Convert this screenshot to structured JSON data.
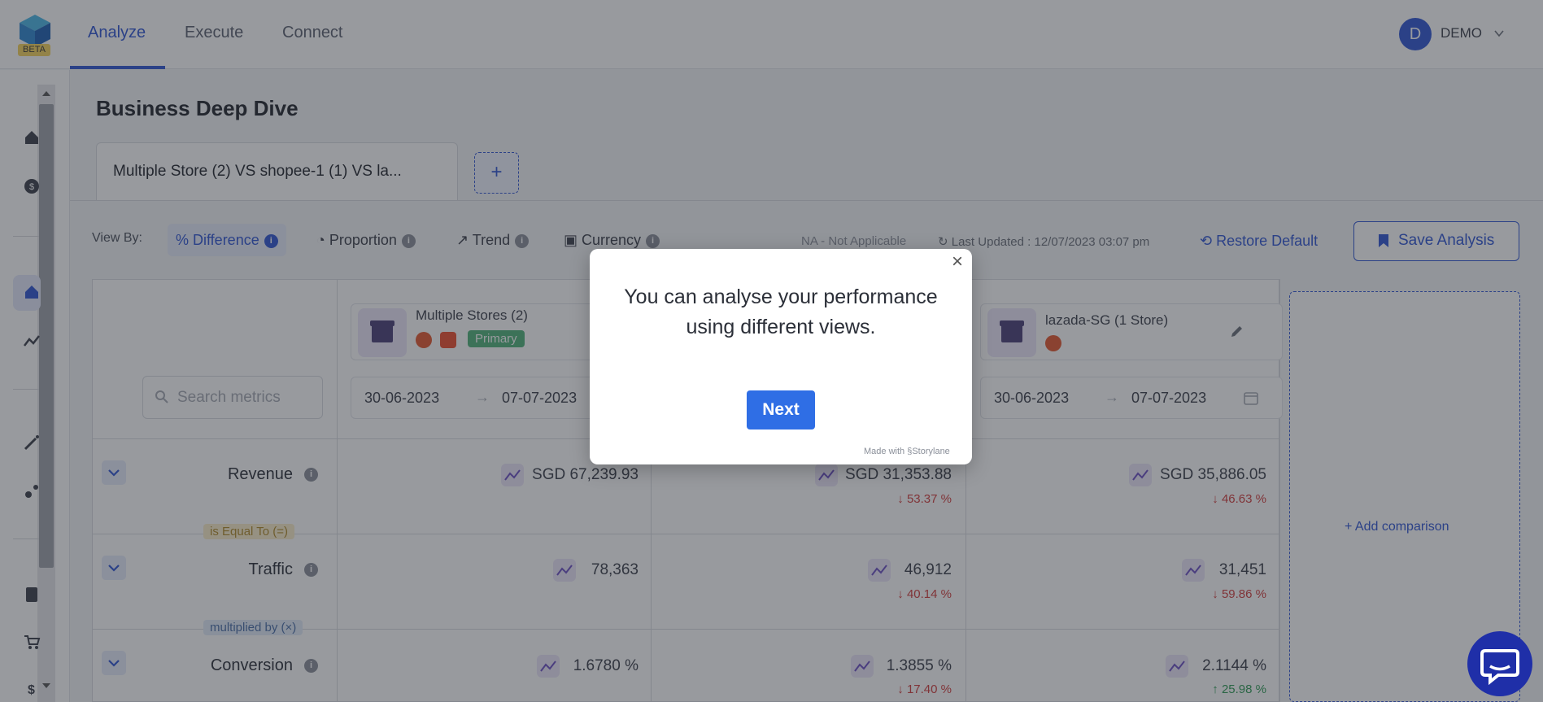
{
  "nav": {
    "beta": "BETA",
    "tabs": [
      "Analyze",
      "Execute",
      "Connect"
    ],
    "active_tab": "Analyze",
    "user_initial": "D",
    "user_name": "DEMO"
  },
  "page": {
    "title": "Business Deep Dive",
    "comparison_tab": "Multiple Store (2) VS shopee-1 (1) VS la...",
    "add_tab": "+"
  },
  "toolbar": {
    "view_by": "View By:",
    "views": [
      "% Difference",
      "Proportion",
      "Trend",
      "Currency"
    ],
    "selected_view": "% Difference",
    "na_note": "NA - Not Applicable",
    "last_updated": "Last Updated : 12/07/2023 03:07 pm",
    "restore": "Restore Default",
    "save": "Save Analysis"
  },
  "table": {
    "search_placeholder": "Search metrics",
    "stores": [
      {
        "name": "Multiple Stores (2)",
        "badge": "Primary",
        "from": "30-06-2023",
        "to": "07-07-2023"
      },
      {
        "name": "",
        "badge": "",
        "from": "",
        "to": ""
      },
      {
        "name": "lazada-SG (1 Store)",
        "badge": "",
        "from": "30-06-2023",
        "to": "07-07-2023"
      }
    ],
    "add_comparison": "Add comparison",
    "relations": [
      "is Equal To (=)",
      "multiplied by (×)"
    ],
    "metrics": [
      {
        "name": "Revenue",
        "values": [
          "SGD 67,239.93",
          "SGD 31,353.88",
          "SGD 35,886.05"
        ],
        "deltas": [
          "",
          "53.37 %",
          "46.63 %"
        ],
        "dirs": [
          "",
          "down",
          "down"
        ]
      },
      {
        "name": "Traffic",
        "values": [
          "78,363",
          "46,912",
          "31,451"
        ],
        "deltas": [
          "",
          "40.14 %",
          "59.86 %"
        ],
        "dirs": [
          "",
          "down",
          "down"
        ]
      },
      {
        "name": "Conversion",
        "values": [
          "1.6780 %",
          "1.3855 %",
          "2.1144 %"
        ],
        "deltas": [
          "",
          "17.40 %",
          "25.98 %"
        ],
        "dirs": [
          "",
          "down",
          "up"
        ]
      }
    ]
  },
  "modal": {
    "text": "You can analyse your performance using different views.",
    "next": "Next",
    "made_with": "Made with",
    "brand": "Storylane"
  },
  "colors": {
    "accent": "#2f55d4",
    "down": "#d23c3c",
    "up": "#2e9c55",
    "next_button": "#2f6ee5",
    "chat": "#1f2fa8"
  }
}
